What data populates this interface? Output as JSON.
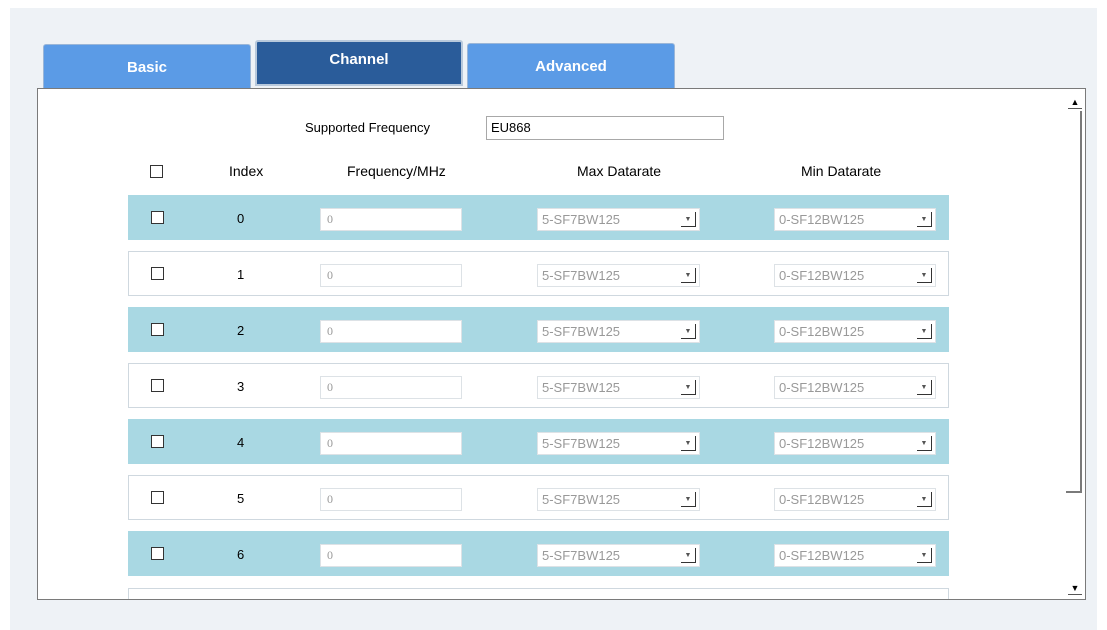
{
  "tabs": [
    {
      "label": "Basic"
    },
    {
      "label": "Channel"
    },
    {
      "label": "Advanced"
    }
  ],
  "supported_frequency": {
    "label": "Supported Frequency",
    "value": "EU868"
  },
  "table": {
    "headers": [
      "Index",
      "Frequency/MHz",
      "Max Datarate",
      "Min Datarate"
    ],
    "rows": [
      {
        "index": "0",
        "frequency": "0",
        "max": "5-SF7BW125",
        "min": "0-SF12BW125"
      },
      {
        "index": "1",
        "frequency": "0",
        "max": "5-SF7BW125",
        "min": "0-SF12BW125"
      },
      {
        "index": "2",
        "frequency": "0",
        "max": "5-SF7BW125",
        "min": "0-SF12BW125"
      },
      {
        "index": "3",
        "frequency": "0",
        "max": "5-SF7BW125",
        "min": "0-SF12BW125"
      },
      {
        "index": "4",
        "frequency": "0",
        "max": "5-SF7BW125",
        "min": "0-SF12BW125"
      },
      {
        "index": "5",
        "frequency": "0",
        "max": "5-SF7BW125",
        "min": "0-SF12BW125"
      },
      {
        "index": "6",
        "frequency": "0",
        "max": "5-SF7BW125",
        "min": "0-SF12BW125"
      }
    ]
  },
  "icons": {
    "scroll_up": "scroll-up-arrow-icon",
    "scroll_down": "scroll-down-arrow-icon",
    "dropdown": "dropdown-arrow-icon"
  },
  "colors": {
    "tab_active": "#2a5c9a",
    "tab_inactive": "#5b9be6",
    "row_alt": "#a9d8e3"
  }
}
